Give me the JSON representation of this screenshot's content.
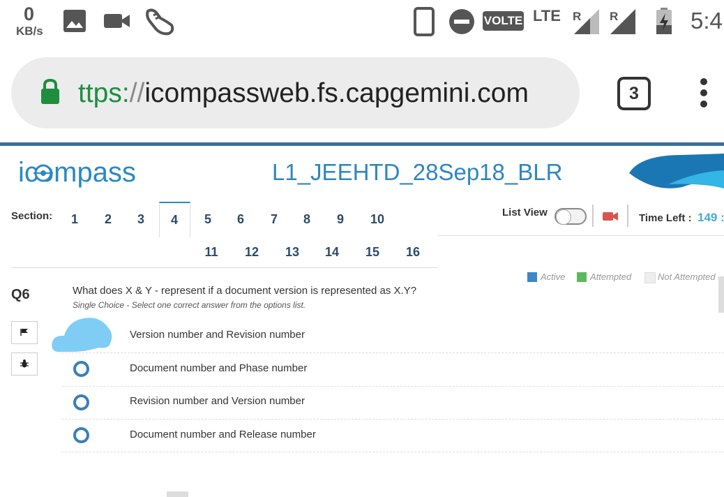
{
  "status_bar": {
    "net_speed_value": "0",
    "net_speed_unit": "KB/s",
    "volte": "VOLTE",
    "lte": "LTE",
    "roaming_1": "R",
    "roaming_2": "R",
    "time": "5:4",
    "icons": [
      "image-icon",
      "video-camera-icon",
      "shoe-icon",
      "phone-outline-icon",
      "do-not-disturb-icon",
      "signal-icon",
      "battery-charging-icon"
    ]
  },
  "browser": {
    "url_scheme": "ttps:",
    "url_slashes": "//",
    "url_host": "icompassweb.fs.capgemini.com",
    "tab_count": "3",
    "icons": [
      "lock-icon",
      "menu-dots-icon"
    ]
  },
  "page_header": {
    "logo_text": "icompass",
    "exam_title": "L1_JEEHTD_28Sep18_BLR"
  },
  "section_nav": {
    "label": "Section:",
    "row1": [
      "1",
      "2",
      "3",
      "4",
      "5",
      "6",
      "7",
      "8",
      "9",
      "10"
    ],
    "row2": [
      "11",
      "12",
      "13",
      "14",
      "15",
      "16"
    ],
    "active": "4"
  },
  "controls": {
    "list_view_label": "List View",
    "time_left_label": "Time Left :",
    "time_left_value": "149 :"
  },
  "legend": {
    "items": [
      {
        "label": "Active",
        "color": "#3b87c8"
      },
      {
        "label": "Attempted",
        "color": "#5cb85c"
      },
      {
        "label": "Not Attempted",
        "color": "#eeeeee"
      }
    ]
  },
  "question": {
    "number": "Q6",
    "text": "What does X & Y - represent if a document version is represented as X.Y?",
    "type": "Single Choice - Select one correct answer from the options list.",
    "options": [
      "Version number and Revision number",
      "Document number and Phase number",
      "Revision number and Version number",
      "Document number and Release number"
    ]
  },
  "colors": {
    "accent": "#2b89c2",
    "header_line": "#3a6f97",
    "cloud_highlight": "#7fcdf5"
  }
}
